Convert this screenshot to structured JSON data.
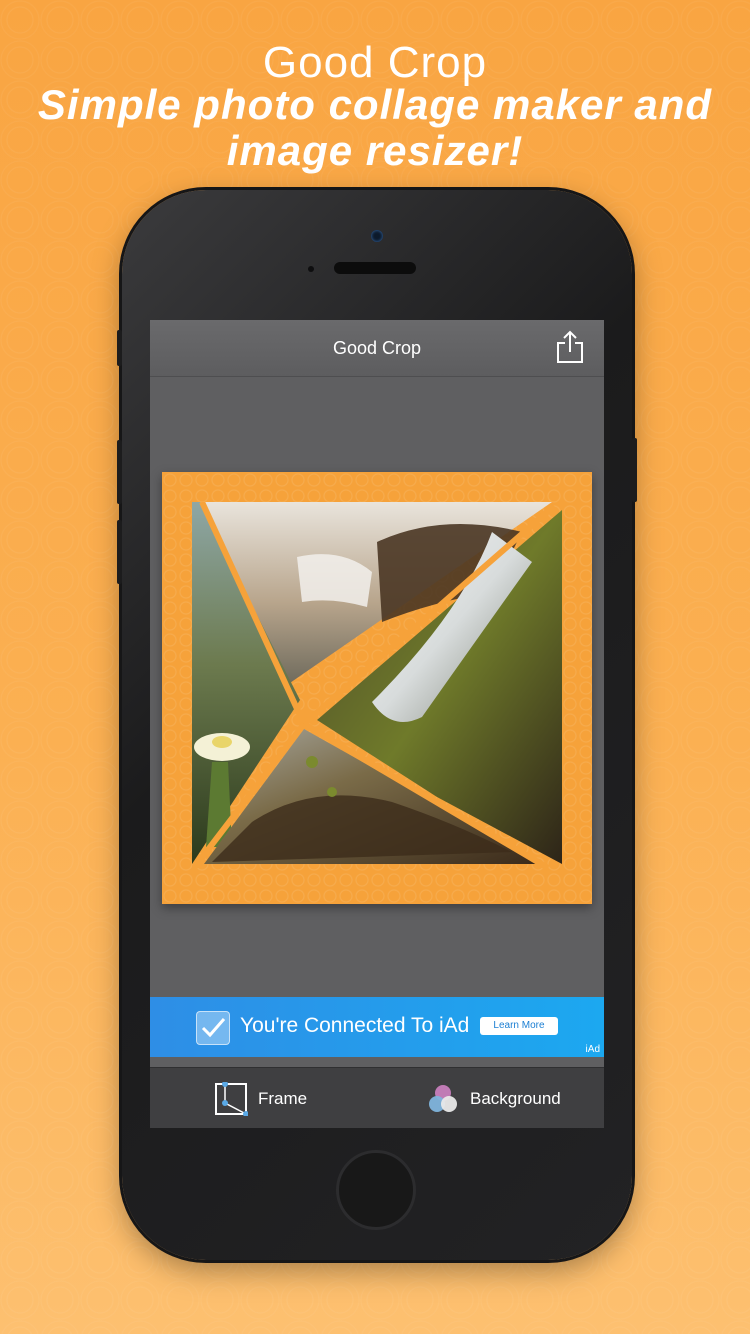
{
  "headline": {
    "title": "Good Crop",
    "subtitle_line1": "Simple photo collage maker and",
    "subtitle_line2": "image resizer!"
  },
  "app": {
    "nav_title": "Good Crop",
    "share_icon": "share-icon"
  },
  "collage": {
    "frame_color": "#f6a23a",
    "layout": "diagonal-5-piece"
  },
  "ad": {
    "text": "You're Connected To iAd",
    "button": "Learn More",
    "tag": "iAd"
  },
  "toolbar": {
    "frame_label": "Frame",
    "background_label": "Background"
  },
  "colors": {
    "background": "#f9a542",
    "ad_blue": "#2e8ee6",
    "toolbar": "#3f3f41"
  }
}
